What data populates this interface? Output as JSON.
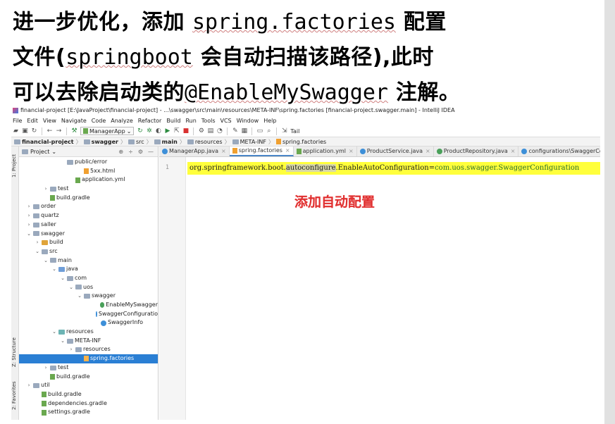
{
  "headings": {
    "line1_prefix": "进一步优化，添加 ",
    "line1_code": "spring.factories",
    "line1_suffix": " 配置",
    "line2_prefix": "文件(",
    "line2_code": "springboot",
    "line2_suffix": " 会自动扫描该路径),此时",
    "line3_prefix": "可以去除启动类的",
    "line3_code": "@EnableMySwagger",
    "line3_suffix": " 注解。"
  },
  "ide": {
    "title": "financial-project [E:\\JavaProject\\financial-project] - ...\\swagger\\src\\main\\resources\\META-INF\\spring.factories [financial-project.swagger.main] - IntelliJ IDEA",
    "menu": [
      "File",
      "Edit",
      "View",
      "Navigate",
      "Code",
      "Analyze",
      "Refactor",
      "Build",
      "Run",
      "Tools",
      "VCS",
      "Window",
      "Help"
    ],
    "toolbar": {
      "run_config": "ManagerApp",
      "tail_label": "Tail"
    },
    "breadcrumb": [
      "financial-project",
      "swagger",
      "src",
      "main",
      "resources",
      "META-INF",
      "spring.factories"
    ],
    "side_tabs": {
      "project": "1: Project",
      "structure": "Z: Structure",
      "favorites": "2: Favorites"
    },
    "panel": {
      "title": "Project"
    },
    "tree": [
      {
        "label": "public/error",
        "depth": 4,
        "arrow": "",
        "icon": "folder"
      },
      {
        "label": "5xx.html",
        "depth": 6,
        "arrow": "",
        "icon": "html"
      },
      {
        "label": "application.yml",
        "depth": 5,
        "arrow": "",
        "icon": "yml"
      },
      {
        "label": "test",
        "depth": 2,
        "arrow": "›",
        "icon": "folder"
      },
      {
        "label": "build.gradle",
        "depth": 2,
        "arrow": "",
        "icon": "gradle"
      },
      {
        "label": "order",
        "depth": 0,
        "arrow": "›",
        "icon": "module"
      },
      {
        "label": "quartz",
        "depth": 0,
        "arrow": "›",
        "icon": "module"
      },
      {
        "label": "saller",
        "depth": 0,
        "arrow": "›",
        "icon": "module"
      },
      {
        "label": "swagger",
        "depth": 0,
        "arrow": "⌄",
        "icon": "module"
      },
      {
        "label": "build",
        "depth": 1,
        "arrow": "›",
        "icon": "excluded"
      },
      {
        "label": "src",
        "depth": 1,
        "arrow": "⌄",
        "icon": "folder"
      },
      {
        "label": "main",
        "depth": 2,
        "arrow": "⌄",
        "icon": "folder"
      },
      {
        "label": "java",
        "depth": 3,
        "arrow": "⌄",
        "icon": "source"
      },
      {
        "label": "com",
        "depth": 4,
        "arrow": "⌄",
        "icon": "folder"
      },
      {
        "label": "uos",
        "depth": 5,
        "arrow": "⌄",
        "icon": "folder"
      },
      {
        "label": "swagger",
        "depth": 6,
        "arrow": "⌄",
        "icon": "folder"
      },
      {
        "label": "EnableMySwagger",
        "depth": 8,
        "arrow": "",
        "icon": "annotation"
      },
      {
        "label": "SwaggerConfiguratio",
        "depth": 8,
        "arrow": "",
        "icon": "class"
      },
      {
        "label": "SwaggerInfo",
        "depth": 8,
        "arrow": "",
        "icon": "class"
      },
      {
        "label": "resources",
        "depth": 3,
        "arrow": "⌄",
        "icon": "resources"
      },
      {
        "label": "META-INF",
        "depth": 4,
        "arrow": "⌄",
        "icon": "folder"
      },
      {
        "label": "resources",
        "depth": 5,
        "arrow": "›",
        "icon": "folder"
      },
      {
        "label": "spring.factories",
        "depth": 6,
        "arrow": "",
        "icon": "factories",
        "selected": true
      },
      {
        "label": "test",
        "depth": 2,
        "arrow": "›",
        "icon": "folder"
      },
      {
        "label": "build.gradle",
        "depth": 2,
        "arrow": "",
        "icon": "gradle"
      },
      {
        "label": "util",
        "depth": 0,
        "arrow": "›",
        "icon": "module"
      },
      {
        "label": "build.gradle",
        "depth": 1,
        "arrow": "",
        "icon": "gradle"
      },
      {
        "label": "dependencies.gradle",
        "depth": 1,
        "arrow": "",
        "icon": "gradle"
      },
      {
        "label": "settings.gradle",
        "depth": 1,
        "arrow": "",
        "icon": "gradle"
      }
    ],
    "tabs": [
      {
        "label": "ManagerApp.java",
        "icon": "class",
        "active": false
      },
      {
        "label": "spring.factories",
        "icon": "factories",
        "active": true
      },
      {
        "label": "application.yml",
        "icon": "yml",
        "active": false
      },
      {
        "label": "ProductService.java",
        "icon": "class",
        "active": false
      },
      {
        "label": "ProductRepository.java",
        "icon": "interface",
        "active": false
      },
      {
        "label": "configurations\\SwaggerConfiguration.ja",
        "icon": "class",
        "active": false
      }
    ],
    "editor": {
      "line_number": "1",
      "code_key_prefix": "org.springframework.boot.",
      "code_key_hl": "autoconfigure",
      "code_key_suffix": ".EnableAutoConfiguration=",
      "code_value": "com.uos.swagger.SwaggerConfiguration",
      "annotation": "添加自动配置"
    }
  },
  "colors": {
    "selection": "#2a7fd4",
    "code_highlight": "#ffff3c",
    "annotation_red": "#e03030"
  }
}
